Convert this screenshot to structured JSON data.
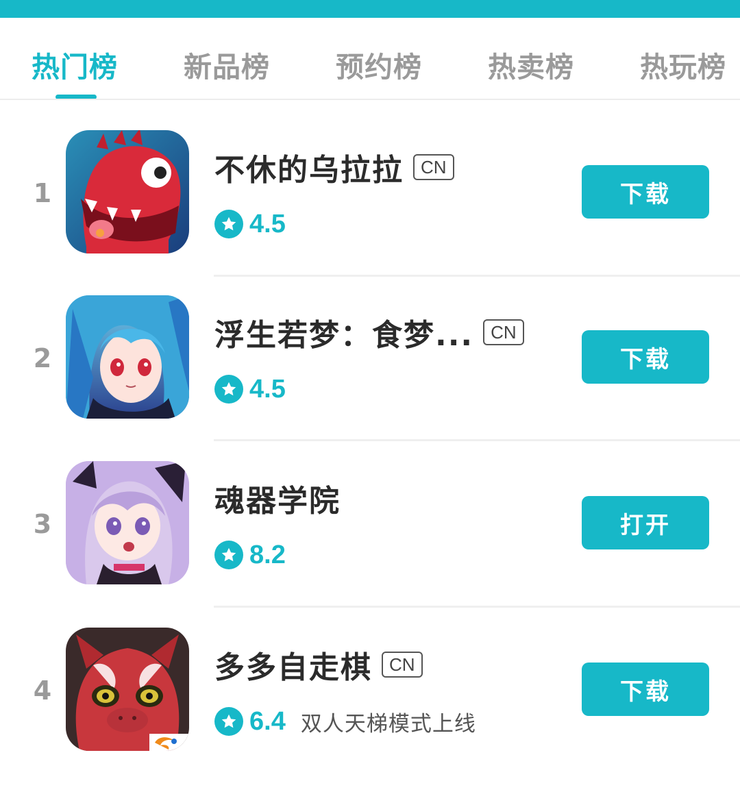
{
  "tabs": [
    {
      "label": "热门榜",
      "active": true
    },
    {
      "label": "新品榜",
      "active": false
    },
    {
      "label": "预约榜",
      "active": false
    },
    {
      "label": "热卖榜",
      "active": false
    },
    {
      "label": "热玩榜",
      "active": false
    }
  ],
  "items": [
    {
      "rank": "1",
      "name": "不休的乌拉拉",
      "badge": "CN",
      "rating": "4.5",
      "subtitle": "",
      "action": "下载",
      "icon": "red-dinosaur-icon"
    },
    {
      "rank": "2",
      "name": "浮生若梦：食梦...",
      "badge": "CN",
      "rating": "4.5",
      "subtitle": "",
      "action": "下载",
      "icon": "blue-hair-anime-girl-icon"
    },
    {
      "rank": "3",
      "name": "魂器学院",
      "badge": "",
      "rating": "8.2",
      "subtitle": "",
      "action": "打开",
      "icon": "purple-hair-anime-girl-icon"
    },
    {
      "rank": "4",
      "name": "多多自走棋",
      "badge": "CN",
      "rating": "6.4",
      "subtitle": "双人天梯模式上线",
      "action": "下载",
      "icon": "red-demon-icon"
    }
  ],
  "colors": {
    "accent": "#17b8c8",
    "inactive_tab": "#9a9a9a",
    "text": "#2b2b2b"
  }
}
